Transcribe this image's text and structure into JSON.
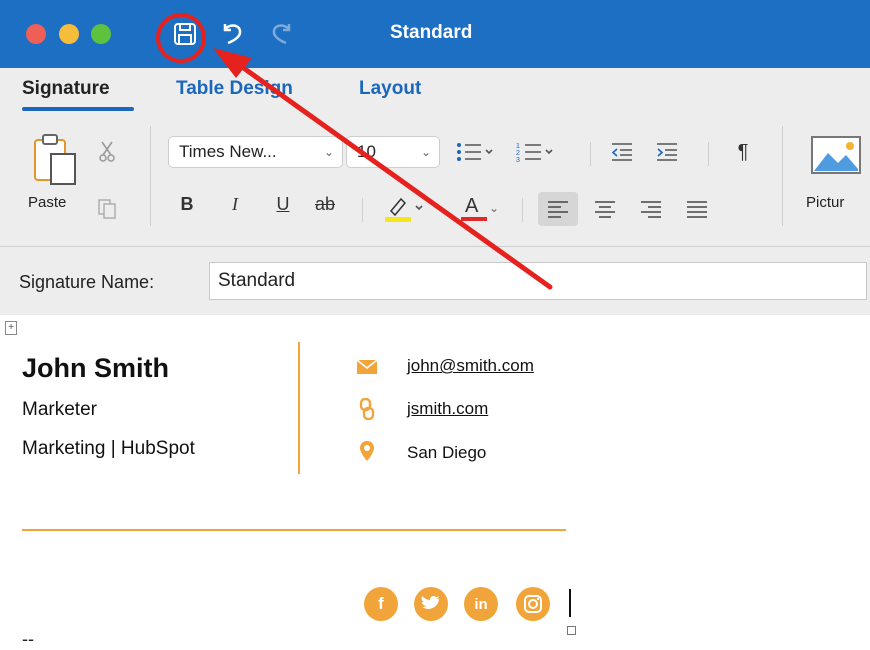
{
  "window": {
    "title": "Standard"
  },
  "tabs": [
    {
      "label": "Signature",
      "active": true
    },
    {
      "label": "Table Design",
      "active": false
    },
    {
      "label": "Layout",
      "active": false
    }
  ],
  "ribbon": {
    "paste_label": "Paste",
    "font_name": "Times New...",
    "font_size": "10",
    "bold": "B",
    "italic": "I",
    "underline": "U",
    "strikethrough": "ab",
    "font_color_letter": "A",
    "pilcrow": "¶",
    "picture_label": "Pictur"
  },
  "signature_name": {
    "label": "Signature Name:",
    "value": "Standard"
  },
  "signature": {
    "name": "John Smith",
    "title": "Marketer",
    "department": "Marketing | HubSpot",
    "email": "john@smith.com",
    "website": "jsmith.com",
    "location": "San Diego",
    "footer": "--",
    "social": [
      {
        "icon": "facebook-icon",
        "glyph": "f"
      },
      {
        "icon": "twitter-icon",
        "glyph": "t"
      },
      {
        "icon": "linkedin-icon",
        "glyph": "in"
      },
      {
        "icon": "instagram-icon",
        "glyph": ""
      }
    ]
  },
  "colors": {
    "titlebar": "#1c6fc2",
    "accent": "#f0a43a",
    "highlight_annotation": "#e5221e",
    "tab_active_underline": "#1b67bd"
  }
}
